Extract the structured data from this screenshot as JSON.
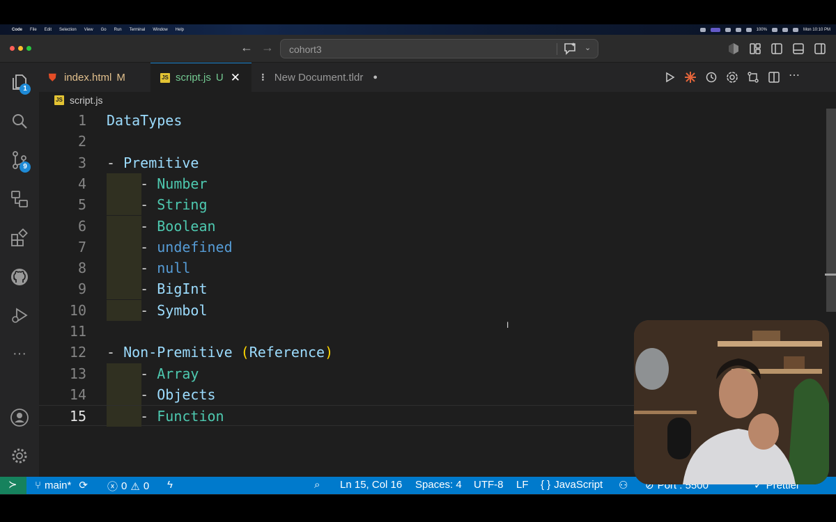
{
  "menubar": {
    "app": "Code",
    "items": [
      "File",
      "Edit",
      "Selection",
      "View",
      "Go",
      "Run",
      "Terminal",
      "Window",
      "Help"
    ],
    "battery": "100%",
    "clock": "Mon 10:10 PM"
  },
  "titlebar": {
    "search_text": "cohort3"
  },
  "activity": {
    "explorer_badge": "1",
    "scm_badge": "9"
  },
  "tabs": [
    {
      "label": "index.html",
      "status": "M"
    },
    {
      "label": "script.js",
      "status": "U"
    },
    {
      "label": "New Document.tldr",
      "status": "●"
    }
  ],
  "breadcrumb": {
    "file": "script.js"
  },
  "editor": {
    "lines": [
      {
        "n": "1",
        "parts": [
          {
            "t": "DataTypes",
            "c": "c-head"
          }
        ]
      },
      {
        "n": "2",
        "parts": []
      },
      {
        "n": "3",
        "parts": [
          {
            "t": "- ",
            "c": "c-dash"
          },
          {
            "t": "Premitive",
            "c": "c-head"
          }
        ]
      },
      {
        "n": "4",
        "parts": [
          {
            "t": "    - ",
            "c": "c-dash"
          },
          {
            "t": "Number",
            "c": "c-type"
          }
        ]
      },
      {
        "n": "5",
        "parts": [
          {
            "t": "    - ",
            "c": "c-dash"
          },
          {
            "t": "String",
            "c": "c-type"
          }
        ]
      },
      {
        "n": "6",
        "parts": [
          {
            "t": "    - ",
            "c": "c-dash"
          },
          {
            "t": "Boolean",
            "c": "c-type"
          }
        ]
      },
      {
        "n": "7",
        "parts": [
          {
            "t": "    - ",
            "c": "c-dash"
          },
          {
            "t": "undefined",
            "c": "c-kw"
          }
        ]
      },
      {
        "n": "8",
        "parts": [
          {
            "t": "    - ",
            "c": "c-dash"
          },
          {
            "t": "null",
            "c": "c-kw"
          }
        ]
      },
      {
        "n": "9",
        "parts": [
          {
            "t": "    - ",
            "c": "c-dash"
          },
          {
            "t": "BigInt",
            "c": "c-head"
          }
        ]
      },
      {
        "n": "10",
        "parts": [
          {
            "t": "    - ",
            "c": "c-dash"
          },
          {
            "t": "Symbol",
            "c": "c-head"
          }
        ]
      },
      {
        "n": "11",
        "parts": []
      },
      {
        "n": "12",
        "parts": [
          {
            "t": "- ",
            "c": "c-dash"
          },
          {
            "t": "Non-Premitive ",
            "c": "c-head"
          },
          {
            "t": "(",
            "c": "c-paren"
          },
          {
            "t": "Reference",
            "c": "c-head"
          },
          {
            "t": ")",
            "c": "c-paren"
          }
        ]
      },
      {
        "n": "13",
        "parts": [
          {
            "t": "    - ",
            "c": "c-dash"
          },
          {
            "t": "Array",
            "c": "c-type"
          }
        ]
      },
      {
        "n": "14",
        "parts": [
          {
            "t": "    - ",
            "c": "c-dash"
          },
          {
            "t": "Objects",
            "c": "c-head"
          }
        ]
      },
      {
        "n": "15",
        "parts": [
          {
            "t": "    - ",
            "c": "c-dash"
          },
          {
            "t": "Function",
            "c": "c-type"
          }
        ]
      }
    ]
  },
  "statusbar": {
    "branch": "main*",
    "errors": "0",
    "warnings": "0",
    "position": "Ln 15, Col 16",
    "spaces": "Spaces: 4",
    "encoding": "UTF-8",
    "eol": "LF",
    "language": "JavaScript",
    "port": "Port : 5500",
    "prettier": "Prettier"
  },
  "colors": {
    "accent": "#007acc",
    "badge": "#1e8ad6",
    "editor_bg": "#1e1e1e"
  }
}
